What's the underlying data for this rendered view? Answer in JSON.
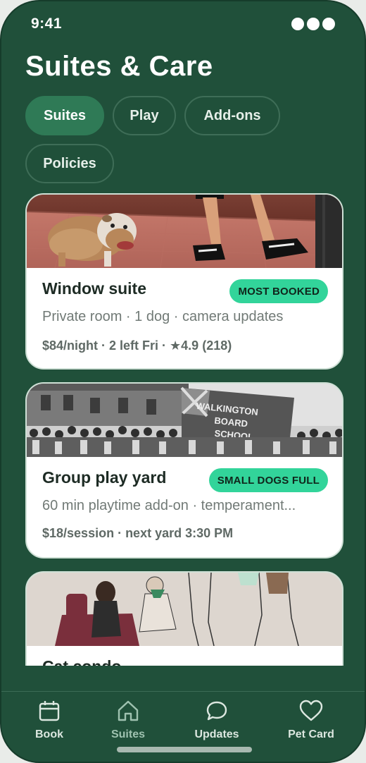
{
  "status": {
    "time": "9:41"
  },
  "header": {
    "title": "Suites & Care"
  },
  "tabs": [
    {
      "label": "Suites",
      "active": true
    },
    {
      "label": "Play",
      "active": false
    },
    {
      "label": "Add-ons",
      "active": false
    },
    {
      "label": "Policies",
      "active": false
    }
  ],
  "cards": [
    {
      "name": "Window suite",
      "badge": "MOST BOOKED",
      "desc": "Private room · 1 dog · camera updates",
      "meta_prefix": "$84/night · 2 left Fri · ",
      "star": "★",
      "meta_rating": "4.9 (218)"
    },
    {
      "name": "Group play yard",
      "badge": "SMALL DOGS FULL",
      "desc": "60 min playtime add-on · temperament...",
      "meta": "$18/session · next yard 3:30 PM",
      "banner_text": [
        "WALKINGTON",
        "BOARD",
        "SCHOOL"
      ]
    },
    {
      "name": "Cat condo"
    }
  ],
  "nav": [
    {
      "label": "Book",
      "icon": "calendar-icon",
      "active": false
    },
    {
      "label": "Suites",
      "icon": "home-icon",
      "active": true
    },
    {
      "label": "Updates",
      "icon": "chat-bubble-icon",
      "active": false
    },
    {
      "label": "Pet Card",
      "icon": "heart-icon",
      "active": false
    }
  ],
  "colors": {
    "background": "#20503a",
    "accent": "#2f7a56",
    "badge": "#32d49a"
  }
}
